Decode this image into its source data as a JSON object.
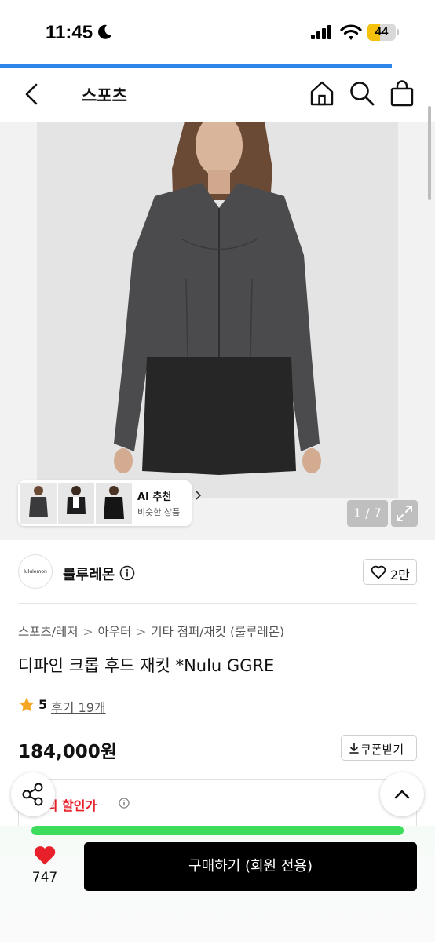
{
  "status_bar": {
    "time": "11:45",
    "battery": "44",
    "battery_level": 0.44
  },
  "page_progress": 0.9,
  "header": {
    "title": "스포츠",
    "icons": [
      "back-icon",
      "home-icon",
      "search-icon",
      "shopping-bag-icon"
    ]
  },
  "gallery": {
    "counter": "1 / 7",
    "ai_recommend": {
      "title": "AI 추천",
      "subtitle": "비슷한 상품"
    }
  },
  "brand": {
    "logo_text": "lululemon",
    "name": "룰루레몬",
    "likes": "2만"
  },
  "breadcrumb": [
    "스포츠/레저",
    "아우터",
    "기타 점퍼/재킷 (룰루레몬)"
  ],
  "product": {
    "title": "디파인 크롭 후드 재킷 *Nulu GGRE",
    "rating": "5",
    "reviews": "후기 19개",
    "price": "184,000원",
    "coupon_label": "쿠폰받기",
    "discount_label": "나의 할인가"
  },
  "bottom_bar": {
    "wish_count": "747",
    "buy_label": "구매하기 (회원 전용)"
  },
  "colors": {
    "accent_blue": "#2f86ea",
    "discount_red": "#e8202a",
    "heart_red": "#e8202a",
    "star_orange": "#f5a623",
    "buy_black": "#000000",
    "bar_green": "#3ddc5c"
  }
}
